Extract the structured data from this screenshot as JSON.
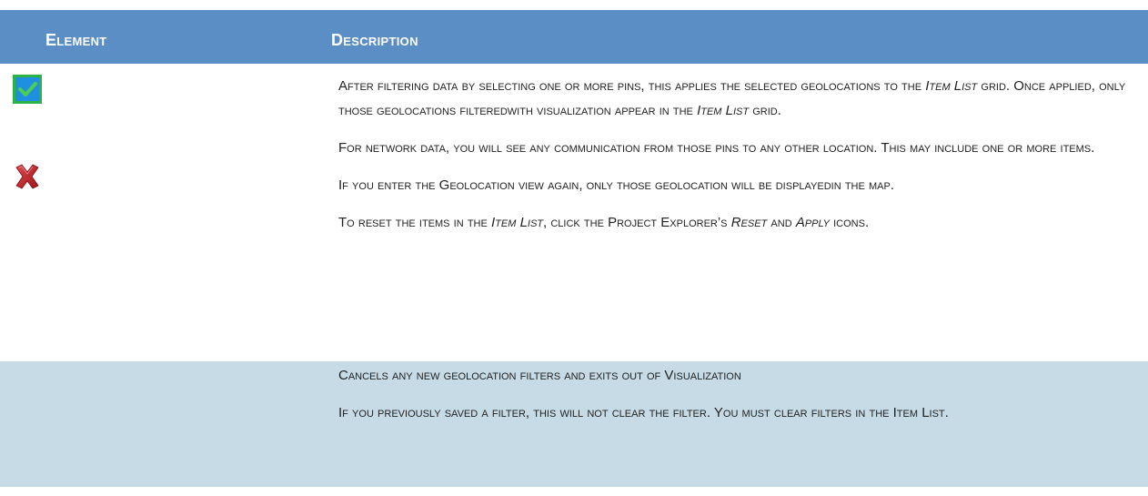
{
  "header": {
    "element_label": "Element",
    "description_label": "Description"
  },
  "rows": [
    {
      "paragraphs": [
        {
          "segments": [
            "After filtering data by selecting one or more pins, this applies the selected geolocations to the ",
            "Item List",
            " grid. Once applied, only those geolocations filteredwith visualization appear in the ",
            "Item List",
            " grid."
          ]
        },
        {
          "segments": [
            "For network data, you will see any communication from those pins to any other location. This may include one or more items."
          ]
        },
        {
          "segments": [
            "If you enter the Geolocation view again, only those geolocation will be displayedin the map."
          ]
        },
        {
          "segments": [
            "To reset the items in the ",
            "Item List",
            ", click the Project Explorer’s ",
            "Reset",
            " and ",
            "Apply",
            " icons."
          ]
        }
      ]
    },
    {
      "paragraphs": [
        {
          "segments": [
            "Cancels any new geolocation filters and exits out of Visualization"
          ]
        },
        {
          "segments": [
            "If you previously saved a filter, this will not clear the filter. You must clear filters in the Item List."
          ]
        }
      ]
    }
  ],
  "icons": {
    "apply": "check-icon",
    "cancel": "x-icon"
  },
  "colors": {
    "header_bg": "#5b8ec5",
    "row_alt_bg": "#c7dbe6",
    "check_green": "#3bb54a",
    "check_blue": "#1f8fe0",
    "x_red": "#c21f25"
  }
}
